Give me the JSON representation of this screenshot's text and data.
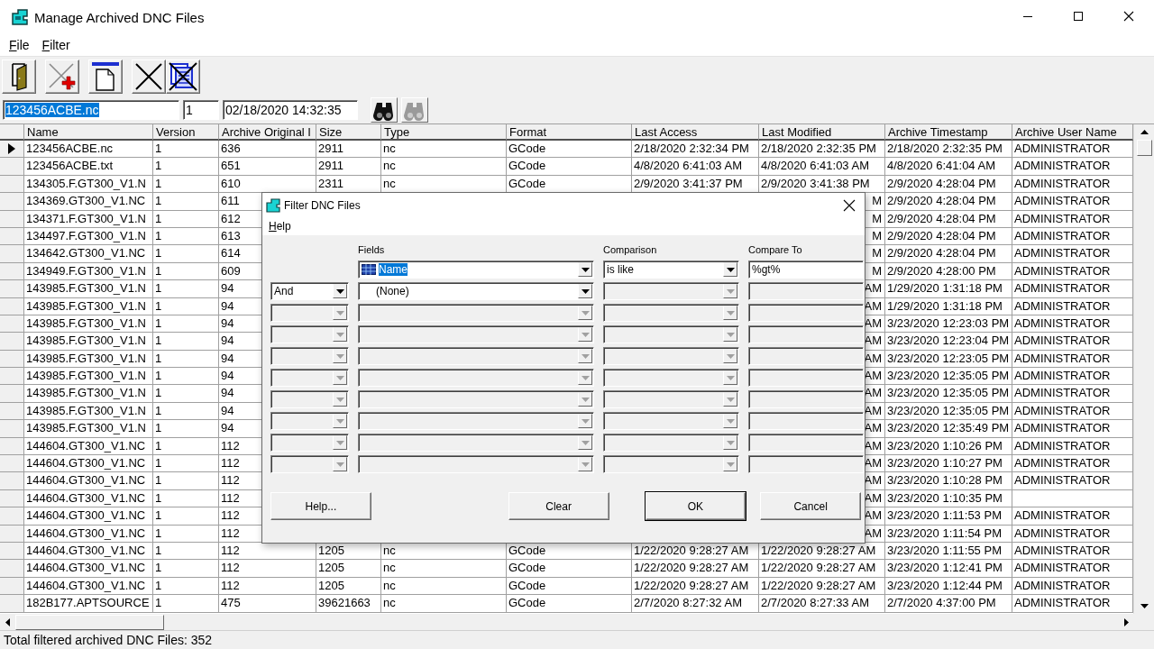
{
  "window": {
    "title": "Manage Archived DNC Files"
  },
  "menu": [
    "File",
    "Filter"
  ],
  "toolbar": [
    {
      "kind": "exit"
    },
    {
      "kind": "add"
    },
    {
      "kind": "new"
    },
    {
      "kind": "delete"
    },
    {
      "kind": "delete_all"
    }
  ],
  "find_bar": {
    "name": {
      "value": "123456ACBE.nc",
      "highlighted": true
    },
    "version": "1",
    "timestamp": "02/18/2020 14:32:35",
    "buttons": [
      {
        "disabled": false
      },
      {
        "disabled": true
      }
    ]
  },
  "table": {
    "columns": [
      "Name",
      "Version",
      "Archive Original I",
      "Size",
      "Type",
      "Format",
      "Last Access",
      "Last Modified",
      "Archive Timestamp",
      "Archive User Name"
    ],
    "rows": [
      {
        "selected": true,
        "cells": [
          "123456ACBE.nc",
          "1",
          "636",
          "2911",
          "nc",
          "GCode",
          "2/18/2020 2:32:34 PM",
          "2/18/2020 2:32:35 PM",
          "2/18/2020 2:32:35 PM",
          "ADMINISTRATOR"
        ]
      },
      {
        "selected": false,
        "cells": [
          "123456ACBE.txt",
          "1",
          "651",
          "2911",
          "nc",
          "GCode",
          "4/8/2020 6:41:03 AM",
          "4/8/2020 6:41:03 AM",
          "4/8/2020 6:41:04 AM",
          "ADMINISTRATOR"
        ]
      },
      {
        "selected": false,
        "cells": [
          "134305.F.GT300_V1.N",
          "1",
          "610",
          "2311",
          "nc",
          "GCode",
          "2/9/2020 3:41:37 PM",
          "2/9/2020 3:41:38 PM",
          "2/9/2020 4:28:04 PM",
          "ADMINISTRATOR"
        ]
      },
      {
        "selected": false,
        "cells": [
          "134369.GT300_V1.NC",
          "1",
          "611",
          null,
          null,
          null,
          null,
          "M",
          "2/9/2020 4:28:04 PM",
          "ADMINISTRATOR"
        ]
      },
      {
        "selected": false,
        "cells": [
          "134371.F.GT300_V1.N",
          "1",
          "612",
          null,
          null,
          null,
          null,
          "M",
          "2/9/2020 4:28:04 PM",
          "ADMINISTRATOR"
        ]
      },
      {
        "selected": false,
        "cells": [
          "134497.F.GT300_V1.N",
          "1",
          "613",
          null,
          null,
          null,
          null,
          "M",
          "2/9/2020 4:28:04 PM",
          "ADMINISTRATOR"
        ]
      },
      {
        "selected": false,
        "cells": [
          "134642.GT300_V1.NC",
          "1",
          "614",
          null,
          null,
          null,
          null,
          "M",
          "2/9/2020 4:28:04 PM",
          "ADMINISTRATOR"
        ]
      },
      {
        "selected": false,
        "cells": [
          "134949.F.GT300_V1.N",
          "1",
          "609",
          null,
          null,
          null,
          null,
          "M",
          "2/9/2020 4:28:00 PM",
          "ADMINISTRATOR"
        ]
      },
      {
        "selected": false,
        "cells": [
          "143985.F.GT300_V1.N",
          "1",
          "94",
          null,
          null,
          null,
          null,
          "AM",
          "1/29/2020 1:31:18 PM",
          "ADMINISTRATOR"
        ]
      },
      {
        "selected": false,
        "cells": [
          "143985.F.GT300_V1.N",
          "1",
          "94",
          null,
          null,
          null,
          null,
          "AM",
          "1/29/2020 1:31:18 PM",
          "ADMINISTRATOR"
        ]
      },
      {
        "selected": false,
        "cells": [
          "143985.F.GT300_V1.N",
          "1",
          "94",
          null,
          null,
          null,
          null,
          "AM",
          "3/23/2020 12:23:03 PM",
          "ADMINISTRATOR"
        ]
      },
      {
        "selected": false,
        "cells": [
          "143985.F.GT300_V1.N",
          "1",
          "94",
          null,
          null,
          null,
          null,
          "AM",
          "3/23/2020 12:23:04 PM",
          "ADMINISTRATOR"
        ]
      },
      {
        "selected": false,
        "cells": [
          "143985.F.GT300_V1.N",
          "1",
          "94",
          null,
          null,
          null,
          null,
          "AM",
          "3/23/2020 12:23:05 PM",
          "ADMINISTRATOR"
        ]
      },
      {
        "selected": false,
        "cells": [
          "143985.F.GT300_V1.N",
          "1",
          "94",
          null,
          null,
          null,
          null,
          "AM",
          "3/23/2020 12:35:05 PM",
          "ADMINISTRATOR"
        ]
      },
      {
        "selected": false,
        "cells": [
          "143985.F.GT300_V1.N",
          "1",
          "94",
          null,
          null,
          null,
          null,
          "AM",
          "3/23/2020 12:35:05 PM",
          "ADMINISTRATOR"
        ]
      },
      {
        "selected": false,
        "cells": [
          "143985.F.GT300_V1.N",
          "1",
          "94",
          null,
          null,
          null,
          null,
          "AM",
          "3/23/2020 12:35:05 PM",
          "ADMINISTRATOR"
        ]
      },
      {
        "selected": false,
        "cells": [
          "143985.F.GT300_V1.N",
          "1",
          "94",
          null,
          null,
          null,
          null,
          "AM",
          "3/23/2020 12:35:49 PM",
          "ADMINISTRATOR"
        ]
      },
      {
        "selected": false,
        "cells": [
          "144604.GT300_V1.NC",
          "1",
          "112",
          null,
          null,
          null,
          null,
          "AM",
          "3/23/2020 1:10:26 PM",
          "ADMINISTRATOR"
        ]
      },
      {
        "selected": false,
        "cells": [
          "144604.GT300_V1.NC",
          "1",
          "112",
          null,
          null,
          null,
          null,
          "AM",
          "3/23/2020 1:10:27 PM",
          "ADMINISTRATOR"
        ]
      },
      {
        "selected": false,
        "cells": [
          "144604.GT300_V1.NC",
          "1",
          "112",
          null,
          null,
          null,
          null,
          "AM",
          "3/23/2020 1:10:28 PM",
          "ADMINISTRATOR"
        ]
      },
      {
        "selected": false,
        "cells": [
          "144604.GT300_V1.NC",
          "1",
          "112",
          null,
          null,
          null,
          null,
          "AM",
          "3/23/2020 1:10:35 PM",
          null
        ]
      },
      {
        "selected": false,
        "cells": [
          "144604.GT300_V1.NC",
          "1",
          "112",
          null,
          null,
          null,
          null,
          "AM",
          "3/23/2020 1:11:53 PM",
          "ADMINISTRATOR"
        ]
      },
      {
        "selected": false,
        "cells": [
          "144604.GT300_V1.NC",
          "1",
          "112",
          null,
          null,
          null,
          null,
          "AM",
          "3/23/2020 1:11:54 PM",
          "ADMINISTRATOR"
        ]
      },
      {
        "selected": false,
        "cells": [
          "144604.GT300_V1.NC",
          "1",
          "112",
          "1205",
          "nc",
          "GCode",
          "1/22/2020 9:28:27 AM",
          "1/22/2020 9:28:27 AM",
          "3/23/2020 1:11:55 PM",
          "ADMINISTRATOR"
        ]
      },
      {
        "selected": false,
        "cells": [
          "144604.GT300_V1.NC",
          "1",
          "112",
          "1205",
          "nc",
          "GCode",
          "1/22/2020 9:28:27 AM",
          "1/22/2020 9:28:27 AM",
          "3/23/2020 1:12:41 PM",
          "ADMINISTRATOR"
        ]
      },
      {
        "selected": false,
        "cells": [
          "144604.GT300_V1.NC",
          "1",
          "112",
          "1205",
          "nc",
          "GCode",
          "1/22/2020 9:28:27 AM",
          "1/22/2020 9:28:27 AM",
          "3/23/2020 1:12:44 PM",
          "ADMINISTRATOR"
        ]
      },
      {
        "selected": false,
        "cells": [
          "182B177.APTSOURCE",
          "1",
          "475",
          "39621663",
          "nc",
          "GCode",
          "2/7/2020 8:27:32 AM",
          "2/7/2020 8:27:33 AM",
          "2/7/2020 4:37:00 PM",
          "ADMINISTRATOR"
        ]
      }
    ]
  },
  "status_bar": "Total filtered archived DNC Files: 352",
  "filter_dialog": {
    "title": "Filter DNC Files",
    "menu": [
      "Help"
    ],
    "column_headers": [
      "Fields",
      "Comparison",
      "Compare To"
    ],
    "criteria": [
      {
        "kind": "first",
        "field": "Name",
        "field_focused": true,
        "field_disabled": false,
        "comparison": "is like",
        "comparison_disabled": false,
        "compare_to": "%gt%",
        "compare_to_disabled": false
      },
      {
        "kind": "next",
        "conjunction": "And",
        "conjunction_disabled": false,
        "field": "(None)",
        "field_focused": false,
        "field_disabled": false,
        "comparison_disabled": true,
        "compare_to_disabled": true
      },
      {
        "kind": "next",
        "conjunction_disabled": true,
        "field_disabled": true,
        "comparison_disabled": true,
        "compare_to_disabled": true
      },
      {
        "kind": "next",
        "conjunction_disabled": true,
        "field_disabled": true,
        "comparison_disabled": true,
        "compare_to_disabled": true
      },
      {
        "kind": "next",
        "conjunction_disabled": true,
        "field_disabled": true,
        "comparison_disabled": true,
        "compare_to_disabled": true
      },
      {
        "kind": "next",
        "conjunction_disabled": true,
        "field_disabled": true,
        "comparison_disabled": true,
        "compare_to_disabled": true
      },
      {
        "kind": "next",
        "conjunction_disabled": true,
        "field_disabled": true,
        "comparison_disabled": true,
        "compare_to_disabled": true
      },
      {
        "kind": "next",
        "conjunction_disabled": true,
        "field_disabled": true,
        "comparison_disabled": true,
        "compare_to_disabled": true
      },
      {
        "kind": "next",
        "conjunction_disabled": true,
        "field_disabled": true,
        "comparison_disabled": true,
        "compare_to_disabled": true
      },
      {
        "kind": "next",
        "conjunction_disabled": true,
        "field_disabled": true,
        "comparison_disabled": true,
        "compare_to_disabled": true
      }
    ],
    "buttons": [
      {
        "label": "Help...",
        "default": false
      },
      {
        "label": "Clear",
        "default": false
      },
      {
        "label": "OK",
        "default": true
      },
      {
        "label": "Cancel",
        "default": false
      }
    ]
  }
}
